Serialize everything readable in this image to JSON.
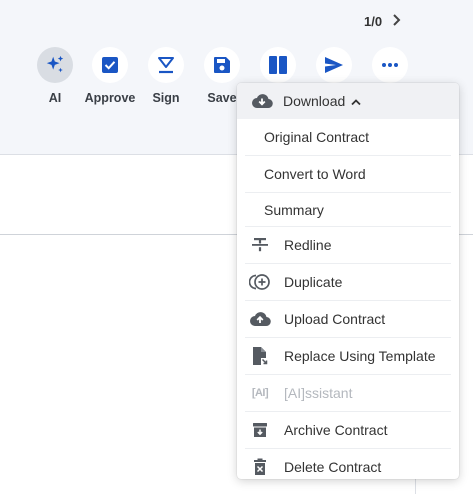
{
  "pager": {
    "text": "1/0"
  },
  "toolbar": [
    {
      "name": "ai-button",
      "label": "AI",
      "icon": "sparkles-icon"
    },
    {
      "name": "approve-button",
      "label": "Approve",
      "icon": "checkbox-icon"
    },
    {
      "name": "sign-button",
      "label": "Sign",
      "icon": "sign-icon"
    },
    {
      "name": "save-button",
      "label": "Save",
      "icon": "save-icon"
    },
    {
      "name": "layout-button",
      "label": "",
      "icon": "columns-icon"
    },
    {
      "name": "send-button",
      "label": "",
      "icon": "send-icon"
    },
    {
      "name": "more-button",
      "label": "",
      "icon": "more-icon"
    }
  ],
  "menu": {
    "download": {
      "label": "Download",
      "icon": "cloud-download-icon"
    },
    "download_options": [
      "Original Contract",
      "Convert to Word",
      "Summary"
    ],
    "items": [
      {
        "label": "Redline",
        "icon": "strikethrough-icon",
        "disabled": false
      },
      {
        "label": "Duplicate",
        "icon": "duplicate-icon",
        "disabled": false
      },
      {
        "label": "Upload Contract",
        "icon": "cloud-upload-icon",
        "disabled": false
      },
      {
        "label": "Replace Using Template",
        "icon": "file-replace-icon",
        "disabled": false
      },
      {
        "label": "[AI]ssistant",
        "icon": "ai-bracket-icon",
        "icon_text": "[AI]",
        "disabled": true
      },
      {
        "label": "Archive Contract",
        "icon": "archive-icon",
        "disabled": false
      },
      {
        "label": "Delete Contract",
        "icon": "trash-icon",
        "disabled": false
      }
    ]
  },
  "colors": {
    "accent": "#1a56c4",
    "toolbar_bg": "#f4f6fa",
    "icon_gray": "#555a61"
  }
}
